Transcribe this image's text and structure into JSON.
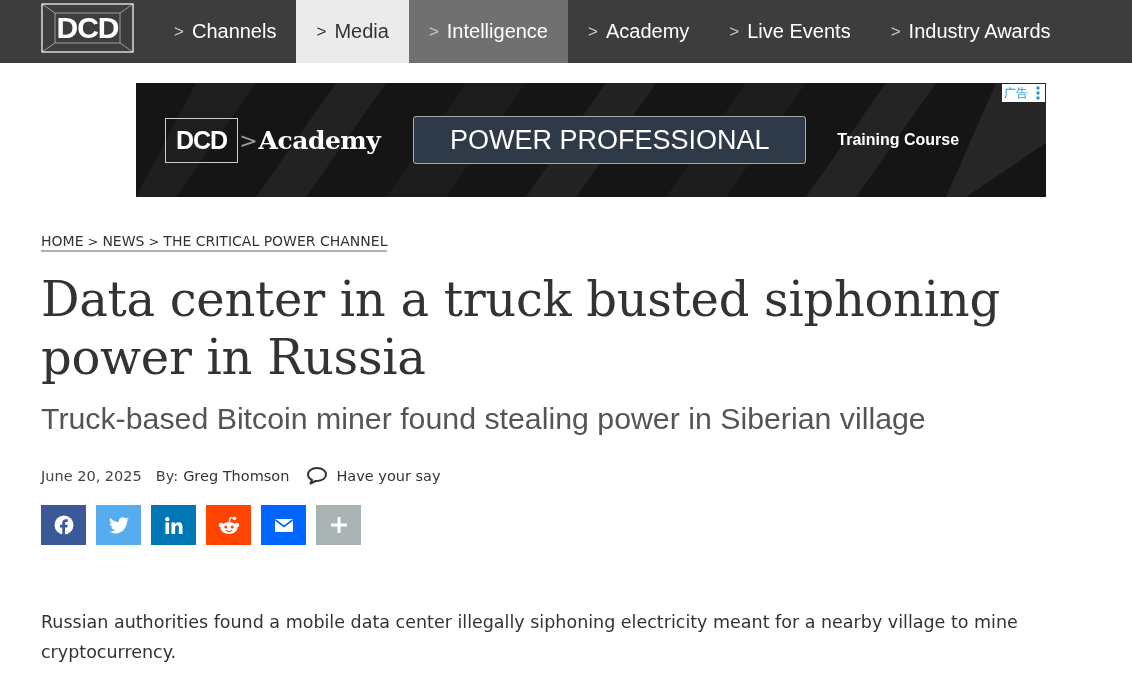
{
  "header": {
    "logo": "DCD",
    "nav": [
      {
        "label": "Channels",
        "arrow": ">",
        "selected": false,
        "highlighted": false
      },
      {
        "label": "Media",
        "arrow": ">",
        "selected": true,
        "highlighted": false
      },
      {
        "label": "Intelligence",
        "arrow": ">",
        "selected": false,
        "highlighted": true
      },
      {
        "label": "Academy",
        "arrow": ">",
        "selected": false,
        "highlighted": false
      },
      {
        "label": "Live Events",
        "arrow": ">",
        "selected": false,
        "highlighted": false
      },
      {
        "label": "Industry Awards",
        "arrow": ">",
        "selected": false,
        "highlighted": false
      }
    ]
  },
  "ad": {
    "label": "广告",
    "logo": "DCD",
    "separator": ">",
    "brand": "Academy",
    "headline": "POWER PROFESSIONAL",
    "tagline": "Training Course"
  },
  "breadcrumb": [
    {
      "label": "HOME"
    },
    {
      "label": "NEWS"
    },
    {
      "label": "THE CRITICAL POWER CHANNEL"
    }
  ],
  "breadcrumb_separator": ">",
  "article": {
    "title": "Data center in a truck busted siphoning power in Russia",
    "subtitle": "Truck-based Bitcoin miner found stealing power in Siberian village",
    "date": "June 20, 2025",
    "byline": "By:",
    "author": "Greg Thomson",
    "comments": "Have your say",
    "share": [
      {
        "kind": "facebook",
        "color": "#3b5998"
      },
      {
        "kind": "twitter",
        "color": "#55acee"
      },
      {
        "kind": "linkedin",
        "color": "#0077b5"
      },
      {
        "kind": "reddit",
        "color": "#ff4500"
      },
      {
        "kind": "email",
        "color": "#0166ff"
      },
      {
        "kind": "more",
        "color": "#a9b3b3"
      }
    ],
    "body": "Russian authorities found a mobile data center illegally siphoning electricity meant for a nearby village to mine cryptocurrency."
  }
}
